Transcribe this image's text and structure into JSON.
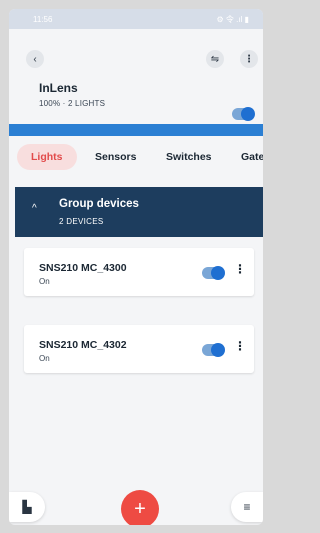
{
  "status_bar": {
    "time": "11:56",
    "icons": "⚙ 令 .ıl ▮"
  },
  "header": {
    "back_icon": "‹",
    "filter_icon": "⇋",
    "more_icon": "⋮",
    "room_name": "InLens",
    "room_summary": "100% · 2 LIGHTS",
    "room_on": true,
    "brightness_percent": 100
  },
  "tabs": [
    {
      "label": "Lights",
      "active": true
    },
    {
      "label": "Sensors",
      "active": false
    },
    {
      "label": "Switches",
      "active": false
    },
    {
      "label": "Gate",
      "active": false
    }
  ],
  "group": {
    "chevron": "^",
    "title": "Group devices",
    "subtitle": "2 DEVICES"
  },
  "devices": [
    {
      "name": "SNS210 MC_4300",
      "state": "On",
      "on": true,
      "more": "⋮"
    },
    {
      "name": "SNS210 MC_4302",
      "state": "On",
      "on": true,
      "more": "⋮"
    }
  ],
  "bottom": {
    "left_icon": "▙",
    "add_icon": "+",
    "right_icon": "≡"
  },
  "colors": {
    "accent_red": "#ee4b43",
    "toggle_blue": "#1f6fd1",
    "group_bar": "#1d3d5e",
    "brightness_bar": "#2b7fd3"
  }
}
